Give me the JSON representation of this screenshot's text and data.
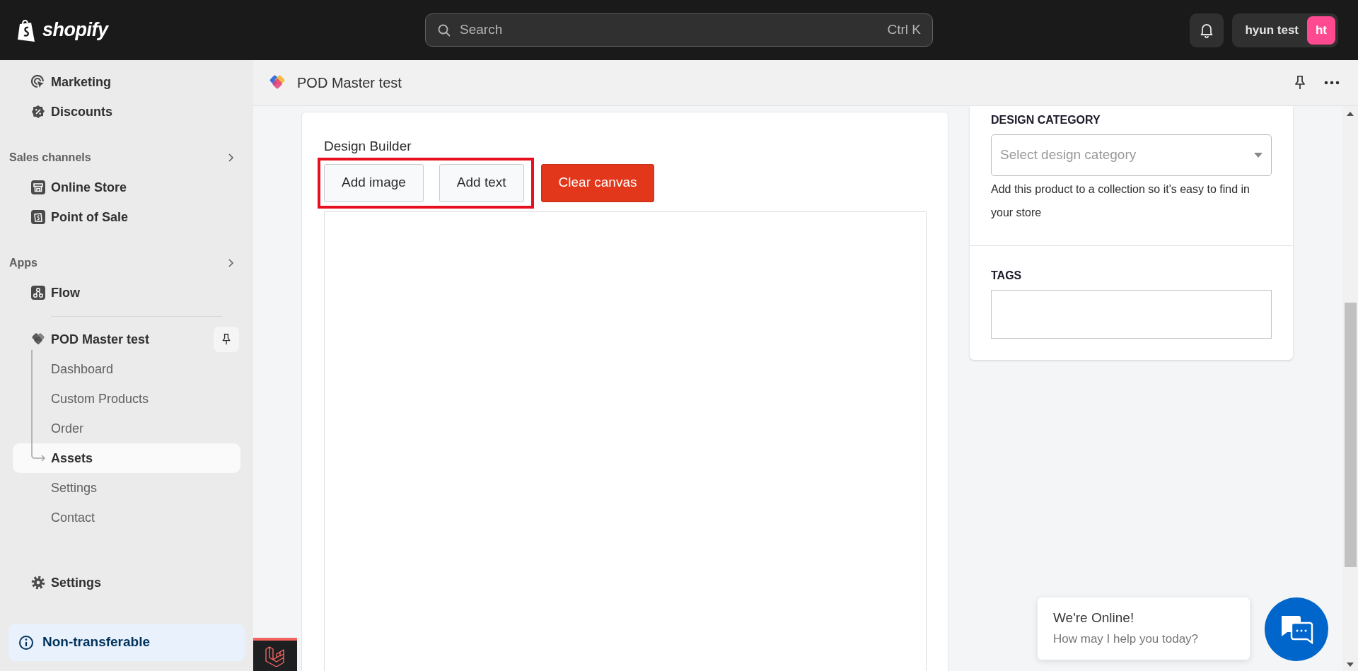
{
  "top_bar": {
    "logo_text": "shopify",
    "search": {
      "placeholder": "Search",
      "shortcut": "Ctrl K"
    },
    "account": {
      "name": "hyun test",
      "initials": "ht",
      "color": "#ff4a91"
    }
  },
  "sidebar": {
    "groups": [
      {
        "items": [
          {
            "label": "Marketing"
          },
          {
            "label": "Discounts"
          }
        ]
      },
      {
        "heading": "Sales channels",
        "items": [
          {
            "label": "Online Store"
          },
          {
            "label": "Point of Sale"
          }
        ]
      },
      {
        "heading": "Apps",
        "items": [
          {
            "label": "Flow"
          }
        ]
      }
    ],
    "app": {
      "name": "POD Master test",
      "children": [
        {
          "label": "Dashboard",
          "selected": false
        },
        {
          "label": "Custom Products",
          "selected": false
        },
        {
          "label": "Order",
          "selected": false
        },
        {
          "label": "Assets",
          "selected": true
        },
        {
          "label": "Settings",
          "selected": false
        },
        {
          "label": "Contact",
          "selected": false
        }
      ]
    },
    "footer_item": {
      "label": "Settings"
    },
    "notice": "Non-transferable"
  },
  "app_header": {
    "title": "POD Master test"
  },
  "design_builder": {
    "title": "Design Builder",
    "buttons": [
      {
        "label": "Add image",
        "kind": "default",
        "highlighted": true
      },
      {
        "label": "Add text",
        "kind": "default",
        "highlighted": true
      },
      {
        "label": "Clear canvas",
        "kind": "danger",
        "highlighted": false
      }
    ]
  },
  "side_panel": {
    "category": {
      "label": "DESIGN CATEGORY",
      "placeholder": "Select design category",
      "help": "Add this product to a collection so it's easy to find in your store"
    },
    "tags": {
      "label": "TAGS"
    }
  },
  "chat": {
    "title": "We're Online!",
    "subtitle": "How may I help you today?"
  }
}
